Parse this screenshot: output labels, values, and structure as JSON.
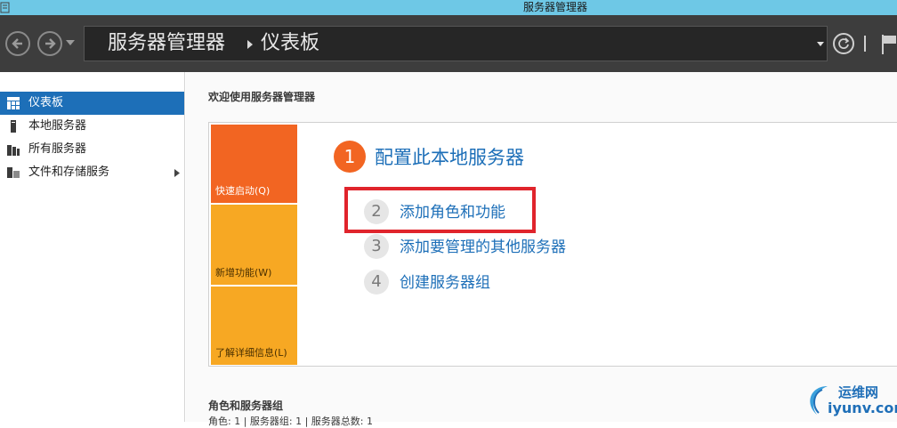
{
  "window": {
    "title": "服务器管理器"
  },
  "nav": {
    "breadcrumb": [
      "服务器管理器",
      "仪表板"
    ],
    "icons": [
      "back-arrow-icon",
      "forward-arrow-icon",
      "chevron-down-icon",
      "refresh-icon",
      "flag-icon"
    ]
  },
  "sidebar": {
    "items": [
      {
        "label": "仪表板",
        "icon": "dashboard-icon",
        "active": true
      },
      {
        "label": "本地服务器",
        "icon": "server-icon",
        "active": false
      },
      {
        "label": "所有服务器",
        "icon": "servers-icon",
        "active": false
      },
      {
        "label": "文件和存储服务",
        "icon": "storage-icon",
        "active": false,
        "has_children": true
      }
    ]
  },
  "main": {
    "welcome": "欢迎使用服务器管理器",
    "tiles": [
      "快速启动(Q)",
      "新增功能(W)",
      "了解详细信息(L)"
    ],
    "steps": [
      {
        "num": "1",
        "label": "配置此本地服务器"
      },
      {
        "num": "2",
        "label": "添加角色和功能"
      },
      {
        "num": "3",
        "label": "添加要管理的其他服务器"
      },
      {
        "num": "4",
        "label": "创建服务器组"
      }
    ],
    "roles_title": "角色和服务器组",
    "roles_summary": "角色: 1 | 服务器组: 1 | 服务器总数: 1"
  },
  "watermark": {
    "top": "运维网",
    "bottom": "iyunv.com"
  },
  "colors": {
    "titlebar": "#6ec8e6",
    "navbar": "#3d3d3d",
    "accent_blue": "#1d6fb8",
    "tile_orange": "#f26522",
    "tile_amber": "#f7a823",
    "highlight_red": "#e0242c"
  }
}
